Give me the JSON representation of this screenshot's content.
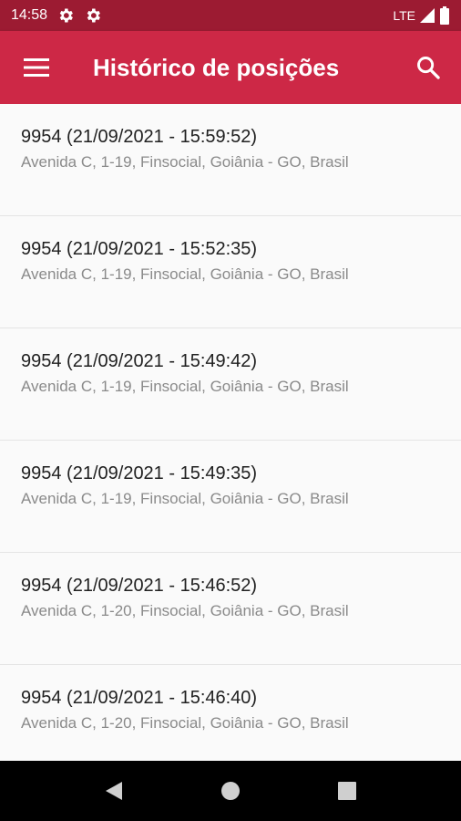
{
  "status_bar": {
    "time": "14:58",
    "network": "LTE",
    "icons": [
      "settings-gear-icon",
      "settings-gear-icon",
      "signal-icon",
      "battery-icon"
    ]
  },
  "app_bar": {
    "title": "Histórico de posições",
    "menu_icon": "hamburger-menu-icon",
    "search_icon": "search-icon",
    "color": "#cd2846"
  },
  "positions": [
    {
      "title": "9954  (21/09/2021 - 15:59:52)",
      "address": "Avenida C, 1-19, Finsocial, Goiânia - GO, Brasil"
    },
    {
      "title": "9954  (21/09/2021 - 15:52:35)",
      "address": "Avenida C, 1-19, Finsocial, Goiânia - GO, Brasil"
    },
    {
      "title": "9954  (21/09/2021 - 15:49:42)",
      "address": "Avenida C, 1-19, Finsocial, Goiânia - GO, Brasil"
    },
    {
      "title": "9954  (21/09/2021 - 15:49:35)",
      "address": "Avenida C, 1-19, Finsocial, Goiânia - GO, Brasil"
    },
    {
      "title": "9954  (21/09/2021 - 15:46:52)",
      "address": "Avenida C, 1-20, Finsocial, Goiânia - GO, Brasil"
    },
    {
      "title": "9954  (21/09/2021 - 15:46:40)",
      "address": "Avenida C, 1-20, Finsocial, Goiânia - GO, Brasil"
    }
  ],
  "nav_bar": {
    "icons": [
      "back-icon",
      "home-icon",
      "recents-icon"
    ]
  }
}
